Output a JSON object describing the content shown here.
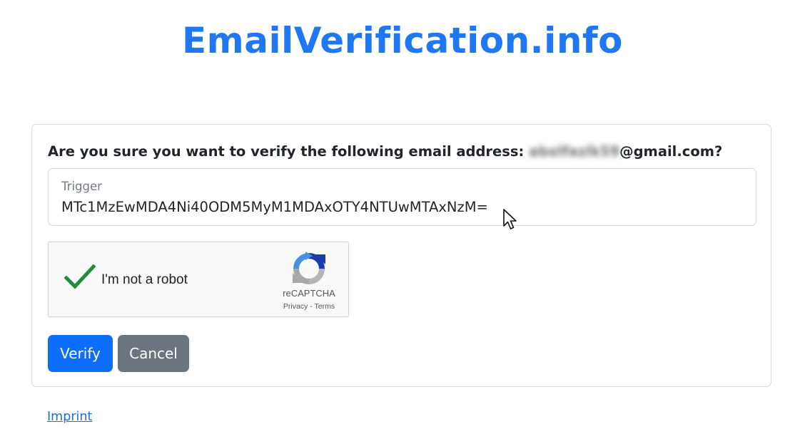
{
  "header": {
    "site_title": "EmailVerification.info"
  },
  "form": {
    "question_prefix": "Are you sure you want to verify the following email address: ",
    "email_local_redacted": "abolfazlk59",
    "email_domain": "@gmail.com?",
    "trigger_label": "Trigger",
    "trigger_value": "MTc1MzEwMDA4Ni40ODM5MyM1MDAxOTY4NTUwMTAxNzM="
  },
  "recaptcha": {
    "checkbox_label": "I'm not a robot",
    "checked": true,
    "brand": "reCAPTCHA",
    "privacy": "Privacy",
    "separator": " - ",
    "terms": "Terms",
    "checkmark_color": "#1e8e3e"
  },
  "buttons": {
    "verify_label": "Verify",
    "cancel_label": "Cancel"
  },
  "footer": {
    "imprint_label": "Imprint"
  },
  "colors": {
    "brand_blue": "#1f78f1",
    "primary": "#0d6efd",
    "secondary": "#6c757d"
  }
}
